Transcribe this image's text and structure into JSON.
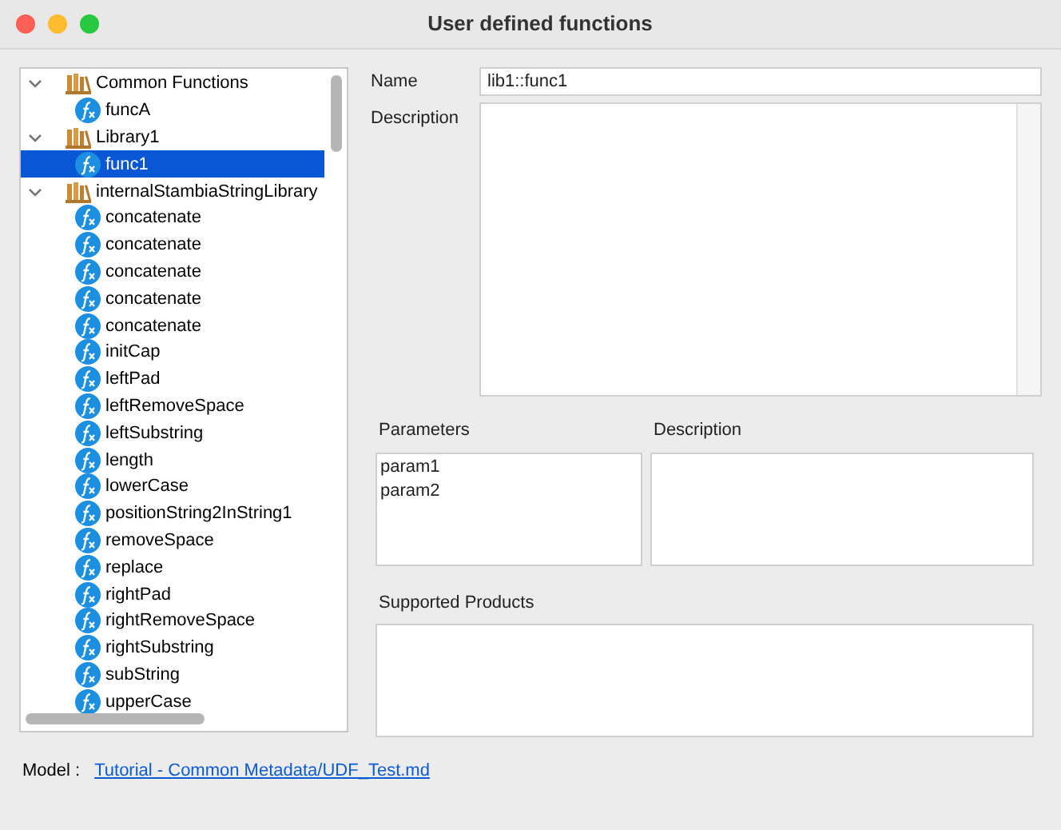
{
  "window": {
    "title": "User defined functions"
  },
  "tree": [
    {
      "label": "Common Functions",
      "kind": "library",
      "expanded": true,
      "selected": false,
      "children": [
        {
          "label": "funcA",
          "kind": "function",
          "selected": false
        }
      ]
    },
    {
      "label": "Library1",
      "kind": "library",
      "expanded": true,
      "selected": false,
      "children": [
        {
          "label": "func1",
          "kind": "function",
          "selected": true
        }
      ]
    },
    {
      "label": "internalStambiaStringLibrary",
      "kind": "library",
      "expanded": true,
      "selected": false,
      "children": [
        {
          "label": "concatenate",
          "kind": "function",
          "selected": false
        },
        {
          "label": "concatenate",
          "kind": "function",
          "selected": false
        },
        {
          "label": "concatenate",
          "kind": "function",
          "selected": false
        },
        {
          "label": "concatenate",
          "kind": "function",
          "selected": false
        },
        {
          "label": "concatenate",
          "kind": "function",
          "selected": false
        },
        {
          "label": "initCap",
          "kind": "function",
          "selected": false
        },
        {
          "label": "leftPad",
          "kind": "function",
          "selected": false
        },
        {
          "label": "leftRemoveSpace",
          "kind": "function",
          "selected": false
        },
        {
          "label": "leftSubstring",
          "kind": "function",
          "selected": false
        },
        {
          "label": "length",
          "kind": "function",
          "selected": false
        },
        {
          "label": "lowerCase",
          "kind": "function",
          "selected": false
        },
        {
          "label": "positionString2InString1",
          "kind": "function",
          "selected": false
        },
        {
          "label": "removeSpace",
          "kind": "function",
          "selected": false
        },
        {
          "label": "replace",
          "kind": "function",
          "selected": false
        },
        {
          "label": "rightPad",
          "kind": "function",
          "selected": false
        },
        {
          "label": "rightRemoveSpace",
          "kind": "function",
          "selected": false
        },
        {
          "label": "rightSubstring",
          "kind": "function",
          "selected": false
        },
        {
          "label": "subString",
          "kind": "function",
          "selected": false
        },
        {
          "label": "upperCase",
          "kind": "function",
          "selected": false
        }
      ]
    }
  ],
  "name": {
    "label": "Name",
    "value": "lib1::func1"
  },
  "description": {
    "label": "Description"
  },
  "parameters": {
    "label": "Parameters",
    "items": [
      "param1",
      "param2"
    ]
  },
  "parameter_description": {
    "label": "Description"
  },
  "supported_products": {
    "label": "Supported Products"
  },
  "model": {
    "label": "Model :",
    "link": "Tutorial - Common Metadata/UDF_Test.md"
  }
}
